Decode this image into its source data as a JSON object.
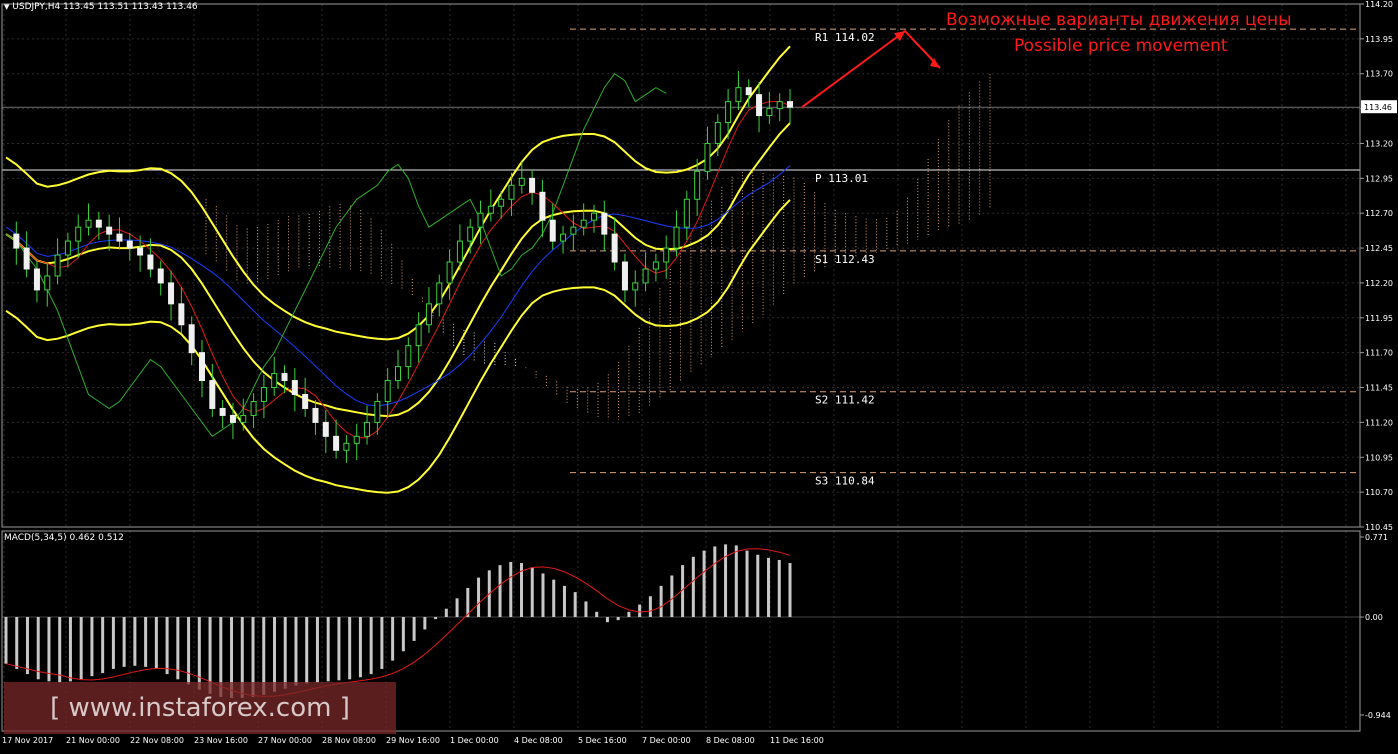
{
  "chart_data": [
    {
      "type": "candlestick",
      "title": "USDJPY,H4  113.45 113.51 113.43 113.46",
      "ylim": [
        110.45,
        114.2
      ],
      "y_ticks": [
        "114.20",
        "113.95",
        "113.70",
        "113.45",
        "113.20",
        "112.95",
        "112.70",
        "112.45",
        "112.20",
        "111.95",
        "111.70",
        "111.45",
        "111.20",
        "110.95",
        "110.70",
        "110.45"
      ],
      "current_price": "113.46",
      "x_tick_labels": [
        "17 Nov 2017",
        "21 Nov 00:00",
        "22 Nov 08:00",
        "23 Nov 16:00",
        "27 Nov 00:00",
        "28 Nov 08:00",
        "29 Nov 16:00",
        "1 Dec 00:00",
        "4 Dec 08:00",
        "5 Dec 16:00",
        "7 Dec 00:00",
        "8 Dec 08:00",
        "11 Dec 16:00"
      ],
      "close_series": [
        112.55,
        112.45,
        112.3,
        112.15,
        112.25,
        112.4,
        112.5,
        112.6,
        112.65,
        112.6,
        112.55,
        112.5,
        112.45,
        112.4,
        112.3,
        112.2,
        112.05,
        111.9,
        111.7,
        111.5,
        111.3,
        111.25,
        111.2,
        111.25,
        111.35,
        111.45,
        111.55,
        111.5,
        111.4,
        111.3,
        111.2,
        111.1,
        111.0,
        111.05,
        111.1,
        111.2,
        111.35,
        111.5,
        111.6,
        111.75,
        111.9,
        112.05,
        112.2,
        112.35,
        112.5,
        112.6,
        112.7,
        112.75,
        112.8,
        112.9,
        112.95,
        112.85,
        112.65,
        112.5,
        112.55,
        112.6,
        112.65,
        112.7,
        112.55,
        112.35,
        112.15,
        112.2,
        112.3,
        112.35,
        112.45,
        112.6,
        112.8,
        113.0,
        113.2,
        113.35,
        113.5,
        113.6,
        113.55,
        113.4,
        113.45,
        113.5,
        113.46
      ],
      "levels": [
        {
          "name": "R1",
          "label": "R1 114.02",
          "value": 114.02
        },
        {
          "name": "P",
          "label": "P 113.01",
          "value": 113.01
        },
        {
          "name": "S1",
          "label": "S1 112.43",
          "value": 112.43
        },
        {
          "name": "S2",
          "label": "S2 111.42",
          "value": 111.42
        },
        {
          "name": "S3",
          "label": "S3 110.84",
          "value": 110.84
        }
      ],
      "annotation_ru": "Возможные варианты движения цены",
      "annotation_en": "Possible price movement"
    },
    {
      "type": "bar",
      "title": "MACD(5,34,5) 0.462 0.512",
      "ylim": [
        -0.944,
        0.771
      ],
      "y_ticks": [
        "0.771",
        "0.00",
        "-0.944"
      ],
      "histogram": [
        -0.45,
        -0.5,
        -0.55,
        -0.6,
        -0.62,
        -0.63,
        -0.62,
        -0.6,
        -0.57,
        -0.54,
        -0.5,
        -0.48,
        -0.47,
        -0.48,
        -0.5,
        -0.55,
        -0.6,
        -0.65,
        -0.7,
        -0.74,
        -0.77,
        -0.78,
        -0.78,
        -0.77,
        -0.75,
        -0.72,
        -0.69,
        -0.66,
        -0.64,
        -0.63,
        -0.62,
        -0.61,
        -0.6,
        -0.58,
        -0.55,
        -0.5,
        -0.42,
        -0.33,
        -0.23,
        -0.12,
        -0.02,
        0.08,
        0.18,
        0.28,
        0.38,
        0.45,
        0.5,
        0.53,
        0.52,
        0.48,
        0.42,
        0.36,
        0.3,
        0.24,
        0.15,
        0.05,
        -0.05,
        -0.03,
        0.05,
        0.12,
        0.2,
        0.3,
        0.4,
        0.5,
        0.58,
        0.64,
        0.68,
        0.7,
        0.69,
        0.64,
        0.6,
        0.57,
        0.55,
        0.52
      ]
    }
  ],
  "watermark": "[ www.instaforex.com ]"
}
